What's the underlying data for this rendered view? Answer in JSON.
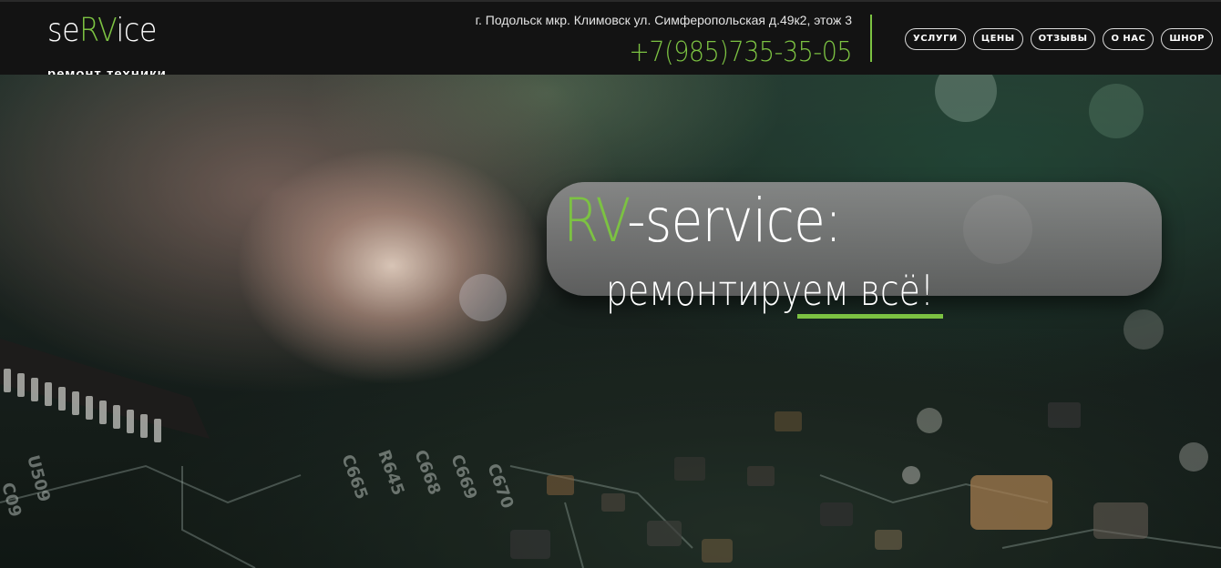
{
  "header": {
    "logo": {
      "part1": "se",
      "accent": "RV",
      "part2": "ice",
      "tagline": "ремонт техники"
    },
    "address": "г. Подольск мкр. Климовск ул. Симферопольская д.49к2, этож 3",
    "phone": "+7(985)735-35-05",
    "nav": [
      {
        "label": "услуги"
      },
      {
        "label": "цены"
      },
      {
        "label": "отзывы"
      },
      {
        "label": "о нас"
      },
      {
        "label": "шнор"
      }
    ]
  },
  "hero": {
    "title_accent": "RV",
    "title_rest": "-service:",
    "subtitle": "ремонтируем всё!"
  },
  "colors": {
    "accent": "#7cc242",
    "header_bg": "#131313",
    "text": "#ffffff"
  }
}
